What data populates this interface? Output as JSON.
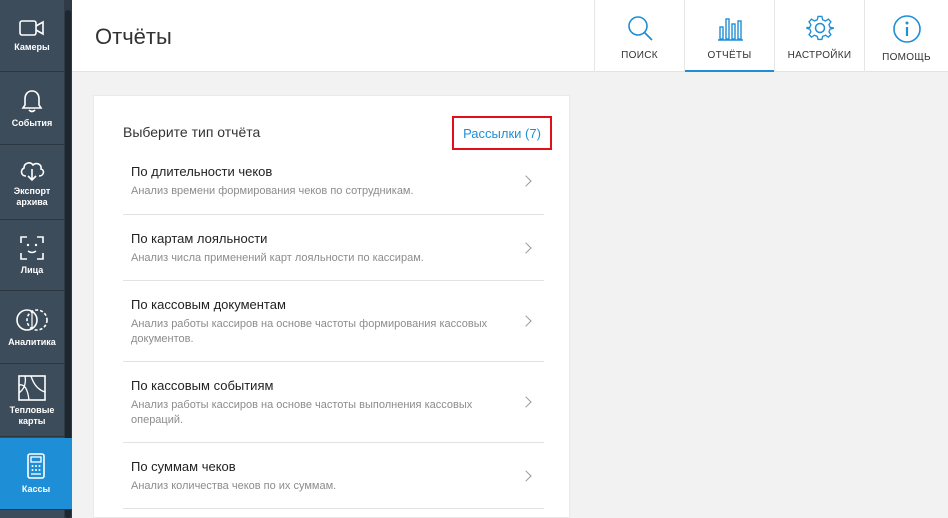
{
  "sidebar": {
    "items": [
      {
        "label": "Камеры",
        "icon": "camera-icon"
      },
      {
        "label": "События",
        "icon": "bell-icon"
      },
      {
        "label": "Экспорт архива",
        "icon": "cloud-download-icon"
      },
      {
        "label": "Лица",
        "icon": "face-icon"
      },
      {
        "label": "Аналитика",
        "icon": "analytics-icon"
      },
      {
        "label": "Тепловые карты",
        "icon": "heatmap-icon"
      },
      {
        "label": "Кассы",
        "icon": "cash-register-icon",
        "active": true
      }
    ]
  },
  "header": {
    "title": "Отчёты",
    "buttons": [
      {
        "label": "ПОИСК",
        "icon": "search-icon"
      },
      {
        "label": "ОТЧЁТЫ",
        "icon": "bar-chart-icon",
        "active": true
      },
      {
        "label": "НАСТРОЙКИ",
        "icon": "gear-icon"
      },
      {
        "label": "ПОМОЩЬ",
        "icon": "info-icon"
      }
    ]
  },
  "card": {
    "title": "Выберите тип отчёта",
    "mailings_label": "Рассылки (7)",
    "reports": [
      {
        "title": "По длительности чеков",
        "desc": "Анализ времени формирования чеков по сотрудникам."
      },
      {
        "title": "По картам лояльности",
        "desc": "Анализ числа применений карт лояльности по кассирам."
      },
      {
        "title": "По кассовым документам",
        "desc": "Анализ работы кассиров на основе частоты формирования кассовых документов."
      },
      {
        "title": "По кассовым событиям",
        "desc": "Анализ работы кассиров на основе частоты выполнения кассовых операций."
      },
      {
        "title": "По суммам чеков",
        "desc": "Анализ количества чеков по их суммам."
      }
    ]
  },
  "colors": {
    "accent": "#1e8fd6",
    "sidebar": "#3d4c5a",
    "highlight_border": "#e0101a"
  }
}
